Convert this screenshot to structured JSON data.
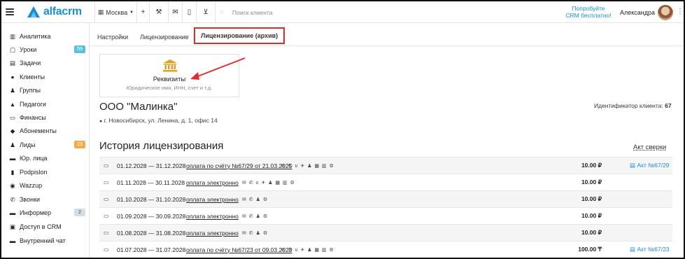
{
  "brand": {
    "name": "alfacrm",
    "color": "#1a8fd8"
  },
  "topbar": {
    "city": "Москва",
    "search_placeholder": "Поиск клиента",
    "promo_line1": "Попробуйте",
    "promo_line2": "CRM бесплатно!",
    "user_name": "Александра"
  },
  "sidebar": {
    "items": [
      {
        "label": "Аналитика",
        "icon": "chart-icon"
      },
      {
        "label": "Уроки",
        "icon": "calendar-icon",
        "badge": "59",
        "badge_color": "#5bc0de"
      },
      {
        "label": "Задачи",
        "icon": "clipboard-icon"
      },
      {
        "label": "Клиенты",
        "icon": "user-icon"
      },
      {
        "label": "Группы",
        "icon": "users-icon"
      },
      {
        "label": "Педагоги",
        "icon": "graduation-icon"
      },
      {
        "label": "Финансы",
        "icon": "money-icon"
      },
      {
        "label": "Абонементы",
        "icon": "tag-icon"
      },
      {
        "label": "Лиды",
        "icon": "user-plus-icon",
        "badge": "23",
        "badge_color": "#f0ad4e"
      },
      {
        "label": "Юр. лица",
        "icon": "briefcase-icon"
      },
      {
        "label": "Podpislon",
        "icon": "document-icon"
      },
      {
        "label": "Wazzup",
        "icon": "whatsapp-icon"
      },
      {
        "label": "Звонки",
        "icon": "phone-icon"
      },
      {
        "label": "Информер",
        "icon": "inbox-icon",
        "badge": "2",
        "badge_color": "#d5dde5"
      },
      {
        "label": "Доступ в CRM",
        "icon": "lock-icon"
      },
      {
        "label": "Внутренний чат",
        "icon": "chat-icon"
      }
    ]
  },
  "tabs": [
    {
      "label": "Настройки"
    },
    {
      "label": "Лицензирование"
    },
    {
      "label": "Лицензирование (архив)",
      "active": true
    }
  ],
  "requisites": {
    "title": "Реквизиты",
    "subtitle": "Юридическое имя, ИНН, счет и т.д."
  },
  "organization": {
    "name": "ООО \"Малинка\"",
    "address": "г. Новосибирск, ул. Ленина, д. 1, офис 14",
    "client_id_label": "Идентификатор клиента:",
    "client_id": "67"
  },
  "history": {
    "title": "История лицензирования",
    "reconciliation_link": "Акт сверки",
    "rows": [
      {
        "period": "01.12.2028 — 31.12.2028",
        "payment": "оплата по счёту №67/29 от 21.03.2025",
        "icons": "✉ ✆ ʋ ✈ ♟ ▦ ▥ ⚙",
        "amount": "10.00 ₽",
        "act": "Акт №67/29"
      },
      {
        "period": "01.11.2028 — 30.11.2028",
        "payment": "оплата электронно",
        "icons": "✉ ✆ ʋ ✈ ♟ ▦ ▥ ⚙",
        "amount": "10.00 ₽",
        "act": ""
      },
      {
        "period": "01.10.2028 — 31.10.2028",
        "payment": "оплата электронно",
        "icons": "✉ ✆ ♟ ⚙",
        "amount": "10.00 ₽",
        "act": ""
      },
      {
        "period": "01.09.2028 — 30.09.2028",
        "payment": "оплата электронно",
        "icons": "✉ ✆ ♟ ⚙",
        "amount": "10.00 ₽",
        "act": ""
      },
      {
        "period": "01.08.2028 — 31.08.2028",
        "payment": "оплата электронно",
        "icons": "✉ ✆ ♟ ⚙",
        "amount": "10.00 ₽",
        "act": ""
      },
      {
        "period": "01.07.2028 — 31.07.2028",
        "payment": "оплата по счёту №67/23 от 09.03.2023",
        "icons": "✉ ✆ ʋ ✈ ♟ ▦ ▥ ⚙",
        "amount": "100.00 ₸",
        "act": "Акт №67/23"
      }
    ]
  }
}
